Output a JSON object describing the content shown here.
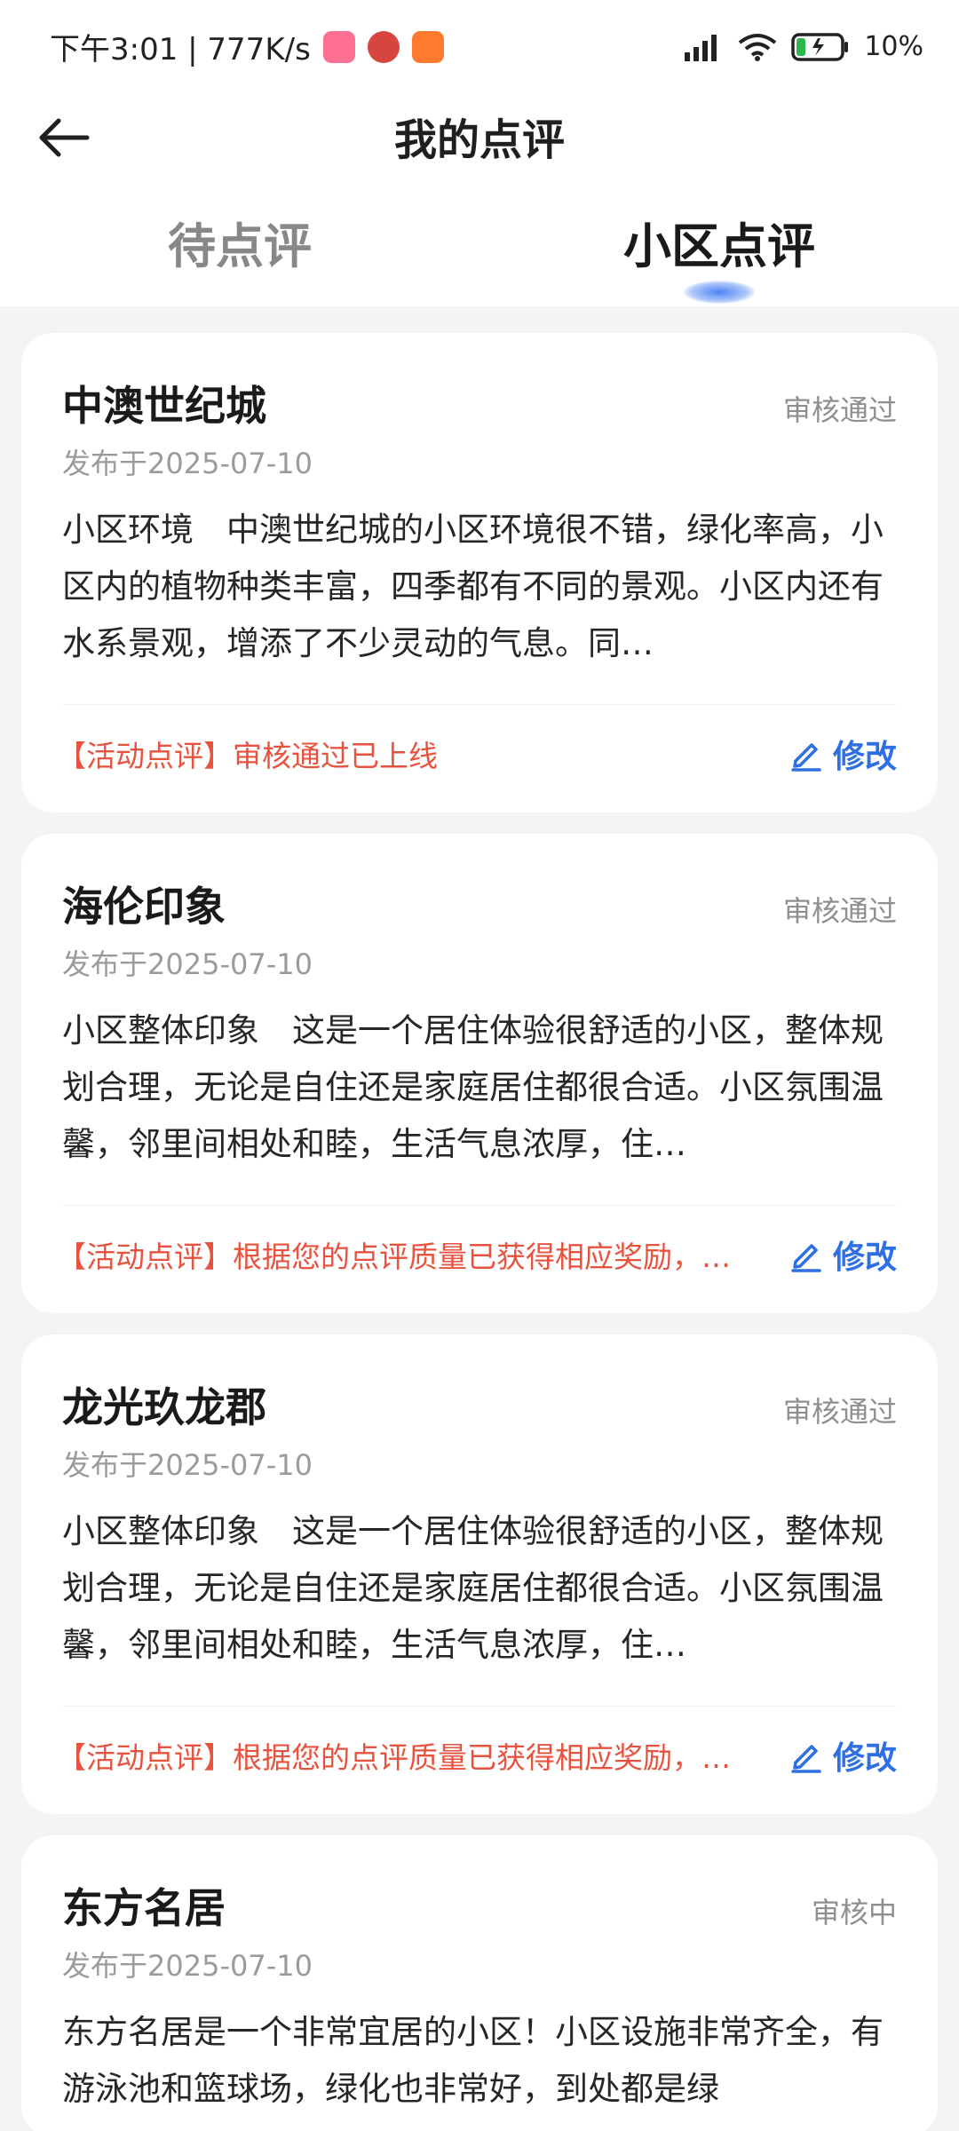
{
  "status_bar": {
    "time_speed": "下午3:01 | 777K/s",
    "battery": "10%"
  },
  "header": {
    "title": "我的点评"
  },
  "tabs": [
    {
      "label": "待点评",
      "active": false
    },
    {
      "label": "小区点评",
      "active": true
    }
  ],
  "reviews": [
    {
      "name": "中澳世纪城",
      "status": "审核通过",
      "date": "发布于2025-07-10",
      "content": "小区环境　中澳世纪城的小区环境很不错，绿化率高，小区内的植物种类丰富，四季都有不同的景观。小区内还有水系景观，增添了不少灵动的气息。同…",
      "activity": "【活动点评】审核通过已上线",
      "edit_label": "修改"
    },
    {
      "name": "海伦印象",
      "status": "审核通过",
      "date": "发布于2025-07-10",
      "content": "小区整体印象　这是一个居住体验很舒适的小区，整体规划合理，无论是自住还是家庭居住都很合适。小区氛围温馨，邻里间相处和睦，生活气息浓厚，住…",
      "activity": "【活动点评】根据您的点评质量已获得相应奖励，…",
      "edit_label": "修改"
    },
    {
      "name": "龙光玖龙郡",
      "status": "审核通过",
      "date": "发布于2025-07-10",
      "content": "小区整体印象　这是一个居住体验很舒适的小区，整体规划合理，无论是自住还是家庭居住都很合适。小区氛围温馨，邻里间相处和睦，生活气息浓厚，住…",
      "activity": "【活动点评】根据您的点评质量已获得相应奖励，…",
      "edit_label": "修改"
    },
    {
      "name": "东方名居",
      "status": "审核中",
      "date": "发布于2025-07-10",
      "content": "东方名居是一个非常宜居的小区！小区设施非常齐全，有游泳池和篮球场，绿化也非常好，到处都是绿"
    }
  ],
  "colors": {
    "accent": "#2f6fe4",
    "activity_red": "#e8533f",
    "indicator": "#4d84f5"
  },
  "icons": {
    "back": "arrow-left-icon",
    "edit": "pencil-edit-icon"
  }
}
